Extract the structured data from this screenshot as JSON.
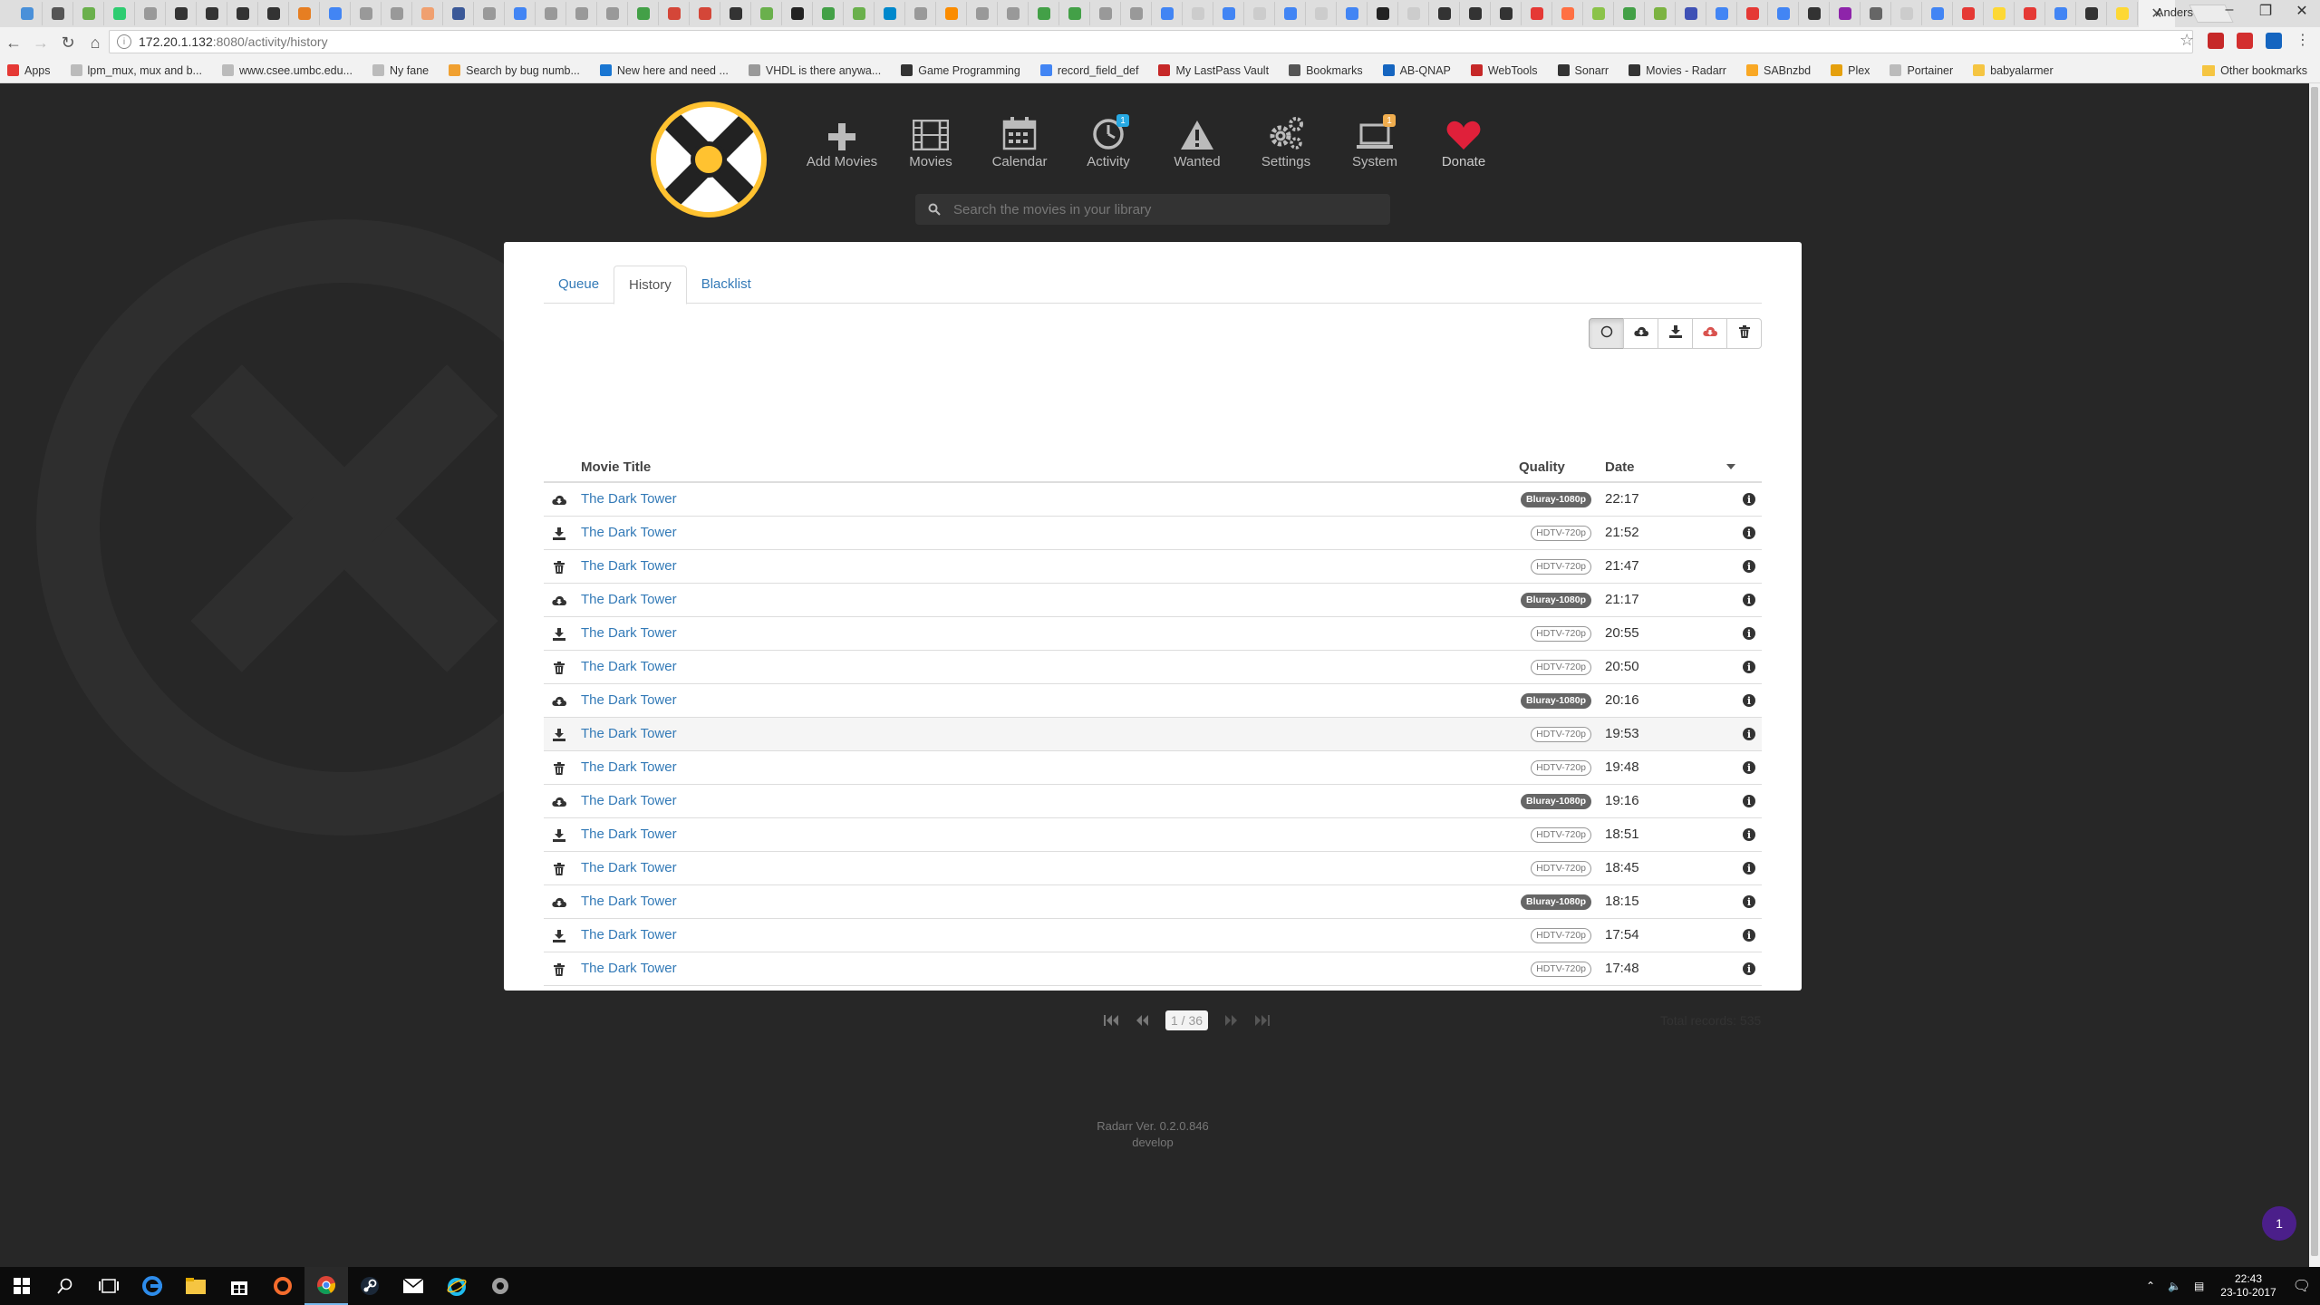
{
  "browser": {
    "profile": "Anders",
    "url_host": "172.20.1.132",
    "url_path": ":8080/activity/history",
    "tab_favicon_colors": [
      "#4a90d9",
      "#555",
      "#6ab04c",
      "#2ecc71",
      "#999",
      "#333",
      "#333",
      "#333",
      "#333",
      "#e67e22",
      "#4285f4",
      "#999",
      "#999",
      "#f0a070",
      "#3b5998",
      "#999",
      "#4285f4",
      "#999",
      "#999",
      "#999",
      "#43a047",
      "#d44638",
      "#d44638",
      "#333",
      "#6ab04c",
      "#222",
      "#43a047",
      "#6ab04c",
      "#0088cc",
      "#999",
      "#fb8c00",
      "#999",
      "#999",
      "#43a047",
      "#43a047",
      "#999",
      "#999",
      "#4285f4",
      "#ccc",
      "#4285f4",
      "#ccc",
      "#4285f4",
      "#ccc",
      "#4285f4",
      "#222",
      "#ccc",
      "#333",
      "#333",
      "#333",
      "#e53935",
      "#ff7043",
      "#8bc34a",
      "#43a047",
      "#7cb342",
      "#3f51b5",
      "#4285f4",
      "#e53935",
      "#4285f4",
      "#333",
      "#8e24aa",
      "#666",
      "#ccc",
      "#4285f4",
      "#e53935",
      "#fdd835",
      "#e53935",
      "#4285f4",
      "#333",
      "#fdd835"
    ],
    "bookmarks": [
      {
        "label": "Apps",
        "color": "#e53935"
      },
      {
        "label": "lpm_mux, mux and b...",
        "color": "#bbb"
      },
      {
        "label": "www.csee.umbc.edu...",
        "color": "#bbb"
      },
      {
        "label": "Ny fane",
        "color": "#bbb"
      },
      {
        "label": "Search by bug numb...",
        "color": "#f0a030"
      },
      {
        "label": "New here and need ...",
        "color": "#1976d2"
      },
      {
        "label": "VHDL is there anywa...",
        "color": "#999"
      },
      {
        "label": "Game Programming",
        "color": "#333"
      },
      {
        "label": "record_field_def",
        "color": "#4285f4"
      },
      {
        "label": "My LastPass Vault",
        "color": "#c62828"
      },
      {
        "label": "Bookmarks",
        "color": "#555"
      },
      {
        "label": "AB-QNAP",
        "color": "#1565c0"
      },
      {
        "label": "WebTools",
        "color": "#c62828"
      },
      {
        "label": "Sonarr",
        "color": "#333"
      },
      {
        "label": "Movies - Radarr",
        "color": "#333"
      },
      {
        "label": "SABnzbd",
        "color": "#f9a825"
      },
      {
        "label": "Plex",
        "color": "#e5a00d"
      },
      {
        "label": "Portainer",
        "color": "#bbb"
      },
      {
        "label": "babyalarmer",
        "color": "#f5c542"
      }
    ],
    "other_bookmarks": "Other bookmarks"
  },
  "nav": {
    "items": [
      {
        "key": "add-movies",
        "label": "Add Movies",
        "icon": "plus-icon"
      },
      {
        "key": "movies",
        "label": "Movies",
        "icon": "film-icon"
      },
      {
        "key": "calendar",
        "label": "Calendar",
        "icon": "calendar-icon"
      },
      {
        "key": "activity",
        "label": "Activity",
        "icon": "clock-icon",
        "badge": "1",
        "badge_color": "#27a9e3"
      },
      {
        "key": "wanted",
        "label": "Wanted",
        "icon": "warning-icon"
      },
      {
        "key": "settings",
        "label": "Settings",
        "icon": "gears-icon"
      },
      {
        "key": "system",
        "label": "System",
        "icon": "laptop-icon",
        "badge": "1",
        "badge_color": "#f0ad4e"
      },
      {
        "key": "donate",
        "label": "Donate",
        "icon": "heart-icon"
      }
    ],
    "search_placeholder": "Search the movies in your library"
  },
  "tabs": [
    {
      "label": "Queue",
      "active": false
    },
    {
      "label": "History",
      "active": true
    },
    {
      "label": "Blacklist",
      "active": false
    }
  ],
  "filters": [
    {
      "key": "all",
      "icon": "circle-icon",
      "active": true
    },
    {
      "key": "grabbed",
      "icon": "cloud-download-icon",
      "active": false
    },
    {
      "key": "imported",
      "icon": "download-icon",
      "active": false
    },
    {
      "key": "failed",
      "icon": "cloud-failed-icon",
      "active": false
    },
    {
      "key": "deleted",
      "icon": "trash-icon",
      "active": false
    }
  ],
  "table": {
    "columns": {
      "title": "Movie Title",
      "quality": "Quality",
      "date": "Date"
    },
    "rows": [
      {
        "event": "grabbed",
        "title": "The Dark Tower",
        "quality": "Bluray-1080p",
        "date": "22:17"
      },
      {
        "event": "imported",
        "title": "The Dark Tower",
        "quality": "HDTV-720p",
        "date": "21:52"
      },
      {
        "event": "deleted",
        "title": "The Dark Tower",
        "quality": "HDTV-720p",
        "date": "21:47"
      },
      {
        "event": "grabbed",
        "title": "The Dark Tower",
        "quality": "Bluray-1080p",
        "date": "21:17"
      },
      {
        "event": "imported",
        "title": "The Dark Tower",
        "quality": "HDTV-720p",
        "date": "20:55"
      },
      {
        "event": "deleted",
        "title": "The Dark Tower",
        "quality": "HDTV-720p",
        "date": "20:50"
      },
      {
        "event": "grabbed",
        "title": "The Dark Tower",
        "quality": "Bluray-1080p",
        "date": "20:16"
      },
      {
        "event": "imported",
        "title": "The Dark Tower",
        "quality": "HDTV-720p",
        "date": "19:53",
        "hover": true
      },
      {
        "event": "deleted",
        "title": "The Dark Tower",
        "quality": "HDTV-720p",
        "date": "19:48"
      },
      {
        "event": "grabbed",
        "title": "The Dark Tower",
        "quality": "Bluray-1080p",
        "date": "19:16"
      },
      {
        "event": "imported",
        "title": "The Dark Tower",
        "quality": "HDTV-720p",
        "date": "18:51"
      },
      {
        "event": "deleted",
        "title": "The Dark Tower",
        "quality": "HDTV-720p",
        "date": "18:45"
      },
      {
        "event": "grabbed",
        "title": "The Dark Tower",
        "quality": "Bluray-1080p",
        "date": "18:15"
      },
      {
        "event": "imported",
        "title": "The Dark Tower",
        "quality": "HDTV-720p",
        "date": "17:54"
      },
      {
        "event": "deleted",
        "title": "The Dark Tower",
        "quality": "HDTV-720p",
        "date": "17:48"
      }
    ]
  },
  "pager": {
    "page": "1 / 36",
    "total": "Total records: 535"
  },
  "footer": {
    "version": "Radarr Ver. 0.2.0.846",
    "branch": "develop"
  },
  "chat_badge": "1",
  "taskbar": {
    "apps": [
      "windows-start-icon",
      "search-icon",
      "task-view-icon",
      "edge-icon",
      "file-explorer-icon",
      "store-icon",
      "origin-icon",
      "chrome-icon",
      "steam-icon",
      "mail-icon",
      "ie-icon",
      "app-icon"
    ],
    "active": "chrome-icon",
    "time": "22:43",
    "date": "23-10-2017"
  },
  "colors": {
    "accent": "#ffc230",
    "link": "#337ab7",
    "failed": "#d9534f"
  }
}
